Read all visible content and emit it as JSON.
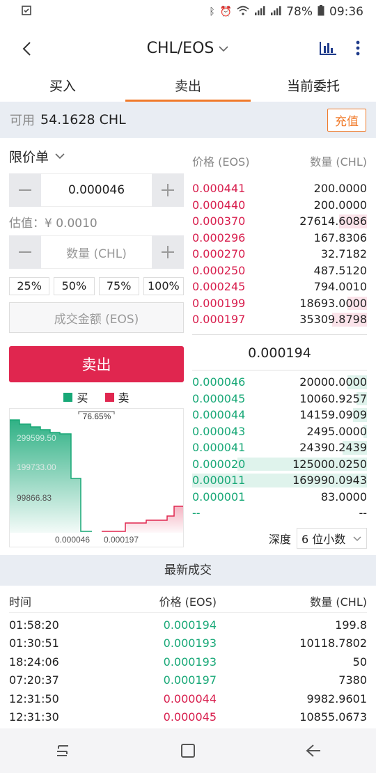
{
  "status_bar": {
    "battery": "78%",
    "time": "09:36"
  },
  "header": {
    "title": "CHL/EOS"
  },
  "tabs": [
    {
      "label": "买入",
      "active": false
    },
    {
      "label": "卖出",
      "active": true
    },
    {
      "label": "当前委托",
      "active": false
    }
  ],
  "available": {
    "label": "可用",
    "value": "54.1628 CHL",
    "deposit": "充值"
  },
  "form": {
    "order_type": "限价单",
    "price": "0.000046",
    "estimate": "估值：¥ 0.0010",
    "qty_placeholder": "数量 (CHL)",
    "percents": [
      "25%",
      "50%",
      "75%",
      "100%"
    ],
    "amount_placeholder": "成交金额 (EOS)",
    "submit": "卖出"
  },
  "legend": {
    "buy": "买",
    "sell": "卖"
  },
  "depth_chart": {
    "buy_color": "#18a877",
    "sell_color": "#e0264f",
    "ratio": "76.65%",
    "y_labels": [
      "299599.50",
      "199733.00",
      "99866.83"
    ],
    "x_labels": [
      "0.000046",
      "0.000197"
    ]
  },
  "orderbook": {
    "price_header": "价格 (EOS)",
    "qty_header": "数量 (CHL)",
    "asks": [
      {
        "price": "0.000441",
        "qty": "200.0000",
        "depth": 0
      },
      {
        "price": "0.000440",
        "qty": "200.0000",
        "depth": 0
      },
      {
        "price": "0.000370",
        "qty": "27614.6086",
        "depth": 0.16
      },
      {
        "price": "0.000296",
        "qty": "167.8306",
        "depth": 0
      },
      {
        "price": "0.000270",
        "qty": "32.7182",
        "depth": 0
      },
      {
        "price": "0.000250",
        "qty": "487.5120",
        "depth": 0
      },
      {
        "price": "0.000245",
        "qty": "794.0010",
        "depth": 0
      },
      {
        "price": "0.000199",
        "qty": "18693.0000",
        "depth": 0.11
      },
      {
        "price": "0.000197",
        "qty": "35309.8798",
        "depth": 0.2
      }
    ],
    "last_price": "0.000194",
    "bids": [
      {
        "price": "0.000046",
        "qty": "20000.0000",
        "depth": 0.11
      },
      {
        "price": "0.000045",
        "qty": "10060.9257",
        "depth": 0.06
      },
      {
        "price": "0.000044",
        "qty": "14159.0909",
        "depth": 0.08
      },
      {
        "price": "0.000043",
        "qty": "2495.0000",
        "depth": 0.02
      },
      {
        "price": "0.000041",
        "qty": "24390.2439",
        "depth": 0.14
      },
      {
        "price": "0.000020",
        "qty": "125000.0250",
        "depth": 0.74
      },
      {
        "price": "0.000011",
        "qty": "169990.0943",
        "depth": 1.0
      },
      {
        "price": "0.000001",
        "qty": "83.0000",
        "depth": 0
      },
      {
        "price": "--",
        "qty": "--",
        "depth": 0
      }
    ],
    "depth_label": "深度",
    "depth_option": "6 位小数"
  },
  "trades": {
    "title": "最新成交",
    "headers": [
      "时间",
      "价格 (EOS)",
      "数量 (CHL)"
    ],
    "rows": [
      {
        "time": "01:58:20",
        "price": "0.000194",
        "qty": "199.8",
        "dir": "up"
      },
      {
        "time": "01:30:51",
        "price": "0.000193",
        "qty": "10118.7802",
        "dir": "up"
      },
      {
        "time": "18:24:06",
        "price": "0.000193",
        "qty": "50",
        "dir": "up"
      },
      {
        "time": "07:20:37",
        "price": "0.000197",
        "qty": "7380",
        "dir": "up"
      },
      {
        "time": "12:31:50",
        "price": "0.000044",
        "qty": "9982.9601",
        "dir": "down"
      },
      {
        "time": "12:31:30",
        "price": "0.000045",
        "qty": "10855.0673",
        "dir": "down"
      }
    ]
  }
}
